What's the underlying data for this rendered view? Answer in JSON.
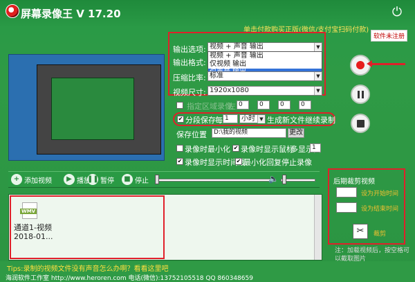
{
  "app": {
    "title": "屏幕录像王 V 17.20",
    "promo": "单击付款购买正版(微信/支付宝扫码付款)",
    "unregistered": "软件未注册"
  },
  "options": {
    "output_option_label": "输出选项:",
    "output_option_value": "视频 + 声音 输出",
    "dropdown_items": [
      "视频 + 声音 输出",
      "仅视频 输出",
      "仅声音 输出"
    ],
    "output_format_label": "输出格式:",
    "compression_label": "压缩比率:",
    "compression_value": "标准",
    "video_size_label": "视频尺寸:",
    "video_size_value": "1920x1080"
  },
  "region": {
    "label": "指定区域录像",
    "x_label": "左",
    "x_value": "0",
    "y_value": "0",
    "w_value": "0",
    "h_value": "0"
  },
  "segment": {
    "checked": "✔",
    "label_prefix": "分段保存",
    "every_label": "每",
    "every_value": "1",
    "unit_value": "小时",
    "suffix": "生成新文件继续录制"
  },
  "save": {
    "label": "保存位置",
    "path": "D:\\我的视频",
    "change_button": "更改"
  },
  "checkboxes": {
    "minimize_label": "录像时最小化",
    "show_mouse_label": "录像时显示鼠标",
    "multi_display_label": "多显示器",
    "multi_display_value": "1",
    "show_time_label": "录像时显示时间线",
    "minimize_restore_label": "最小化回复停止录像"
  },
  "toolbar": {
    "add_video": "添加视频",
    "play": "播放",
    "pause": "暂停",
    "stop": "停止"
  },
  "file_list": {
    "icon_label": "WMV",
    "name": "通道1-视频",
    "date": "2018-01..."
  },
  "crop": {
    "title": "后期裁剪视频",
    "start_label": "设为开始时间",
    "end_label": "设为结束时间",
    "crop_button": "裁剪",
    "note": "注：加载视频后，按空格可以截取图片"
  },
  "status": {
    "tip": "Tips:录制的视频文件没有声音怎么办啊？看看这里吧",
    "footer": "海润软件工作室  http://www.heroren.com   电话(微信):13752105518  QQ 860348659"
  }
}
